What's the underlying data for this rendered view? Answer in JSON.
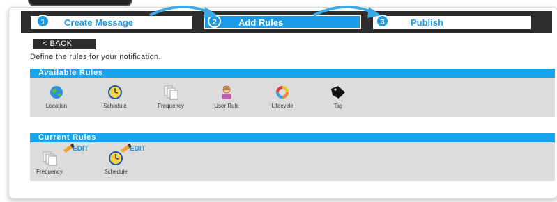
{
  "wizard": {
    "steps": [
      {
        "number": "1",
        "label": "Create Message",
        "state": "complete"
      },
      {
        "number": "2",
        "label": "Add Rules",
        "state": "active"
      },
      {
        "number": "3",
        "label": "Publish",
        "state": "upcoming"
      }
    ]
  },
  "back_button": "< BACK",
  "instruction": "Define the rules for your notification.",
  "available_rules": {
    "title": "Available Rules",
    "items": [
      {
        "label": "Location",
        "icon": "globe-icon"
      },
      {
        "label": "Schedule",
        "icon": "clock-icon"
      },
      {
        "label": "Frequency",
        "icon": "pages-icon"
      },
      {
        "label": "User Rule",
        "icon": "user-icon"
      },
      {
        "label": "Lifecycle",
        "icon": "cycle-icon"
      },
      {
        "label": "Tag",
        "icon": "tag-icon"
      }
    ]
  },
  "current_rules": {
    "title": "Current Rules",
    "items": [
      {
        "label": "Frequency",
        "edit_label": "EDIT",
        "icon": "pages-icon"
      },
      {
        "label": "Schedule",
        "edit_label": "EDIT",
        "icon": "clock-icon"
      }
    ]
  },
  "colors": {
    "accent": "#17a6ee",
    "dark": "#2d2d2d",
    "panel": "#dcdcdc"
  }
}
